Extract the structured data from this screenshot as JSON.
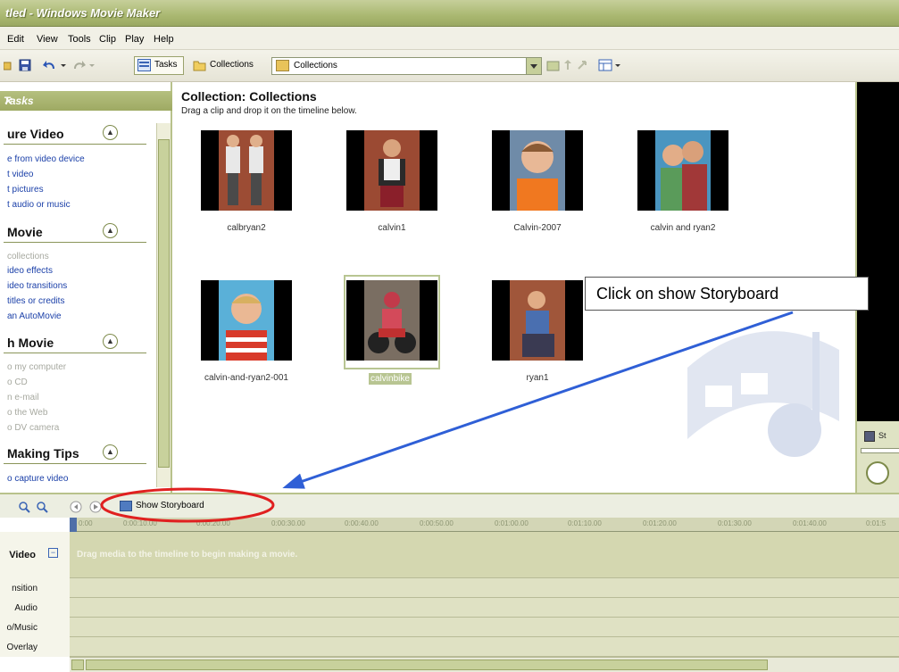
{
  "window": {
    "title": "tled - Windows Movie Maker"
  },
  "menu": [
    "Edit",
    "View",
    "Tools",
    "Clip",
    "Play",
    "Help"
  ],
  "toolbar": {
    "tasks_label": "Tasks",
    "collections_label": "Collections",
    "combo_value": "Collections"
  },
  "tasks_pane": {
    "header": "Tasks",
    "sections": [
      {
        "title": "ure Video",
        "items": [
          {
            "label": "e from video device",
            "enabled": true
          },
          {
            "label": "t video",
            "enabled": true
          },
          {
            "label": "t pictures",
            "enabled": true
          },
          {
            "label": "t audio or music",
            "enabled": true
          }
        ]
      },
      {
        "title": "Movie",
        "items": [
          {
            "label": "collections",
            "enabled": false
          },
          {
            "label": "ideo effects",
            "enabled": true
          },
          {
            "label": "ideo transitions",
            "enabled": true
          },
          {
            "label": "titles or credits",
            "enabled": true
          },
          {
            "label": "an AutoMovie",
            "enabled": true
          }
        ]
      },
      {
        "title": "h Movie",
        "items": [
          {
            "label": "o my computer",
            "enabled": false
          },
          {
            "label": "o CD",
            "enabled": false
          },
          {
            "label": "n e-mail",
            "enabled": false
          },
          {
            "label": "o the Web",
            "enabled": false
          },
          {
            "label": "o DV camera",
            "enabled": false
          }
        ]
      },
      {
        "title": "Making Tips",
        "items": [
          {
            "label": "o capture video",
            "enabled": true
          }
        ]
      }
    ]
  },
  "collection": {
    "title": "Collection: Collections",
    "subtitle": "Drag a clip and drop it on the timeline below.",
    "clips": [
      {
        "label": "calbryan2",
        "selected": false
      },
      {
        "label": "calvin1",
        "selected": false
      },
      {
        "label": "Calvin-2007",
        "selected": false
      },
      {
        "label": "calvin and ryan2",
        "selected": false
      },
      {
        "label": "calvin-and-ryan2-001",
        "selected": false
      },
      {
        "label": "calvinbike",
        "selected": true
      },
      {
        "label": "ryan1",
        "selected": false
      }
    ]
  },
  "preview": {
    "status_prefix": "St"
  },
  "timeline": {
    "show_storyboard_label": "Show Storyboard",
    "ruler_ticks": [
      "0:00",
      "0:00:10.00",
      "0:00:20.00",
      "0:00:30.00",
      "0:00:40.00",
      "0:00:50.00",
      "0:01:00.00",
      "0:01:10.00",
      "0:01:20.00",
      "0:01:30.00",
      "0:01:40.00",
      "0:01:5"
    ],
    "tracks": [
      "Video",
      "nsition",
      "Audio",
      "o/Music",
      "Overlay"
    ],
    "drag_hint": "Drag media to the timeline to begin making a movie."
  },
  "annotation": {
    "callout_text": "Click on show Storyboard",
    "arrow_color": "#2f5fd6",
    "ellipse_color": "#e02020"
  }
}
